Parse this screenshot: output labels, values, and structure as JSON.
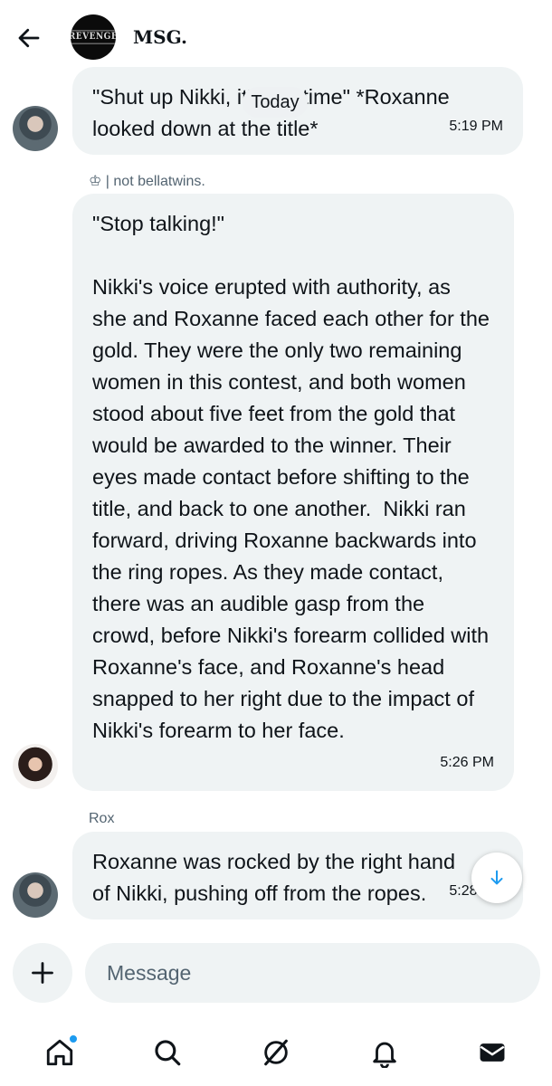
{
  "header": {
    "title": "MSG.",
    "avatar_logo_text": "REVENGE",
    "icons": {
      "back": "arrow-left-icon"
    }
  },
  "date_divider": "Today",
  "messages": [
    {
      "text": "\"Shut up Nikki, it's my time\" *Roxanne looked down at the title*",
      "time": "5:19 PM"
    },
    {
      "sender": "♔ | not bellatwins.",
      "text": "\"Stop talking!\"\n\nNikki's voice erupted with authority, as she and Roxanne faced each other for the gold. They were the only two remaining women in this contest, and both women stood about five feet from the gold that would be awarded to the winner. Their eyes made contact before shifting to the title, and back to one another.  Nikki ran forward, driving Roxanne backwards into the ring ropes. As they made contact, there was an audible gasp from the crowd, before Nikki's forearm collided with Roxanne's face, and Roxanne's head snapped to her right due to the impact of Nikki's forearm to her face.",
      "time": "5:26 PM"
    },
    {
      "sender": "Rox",
      "text": "Roxanne was rocked by the right hand of Nikki, pushing off from the ropes.",
      "time": "5:28 PM"
    }
  ],
  "composer": {
    "placeholder": "Message",
    "value": ""
  },
  "nav": {
    "items": [
      "home-icon",
      "search-icon",
      "grok-icon",
      "notifications-icon",
      "messages-icon"
    ],
    "active_dot_color": "#1d9bf0"
  },
  "colors": {
    "bubble_bg": "#eff3f4",
    "text": "#0f1419",
    "secondary_text": "#536471",
    "accent": "#1d9bf0"
  }
}
